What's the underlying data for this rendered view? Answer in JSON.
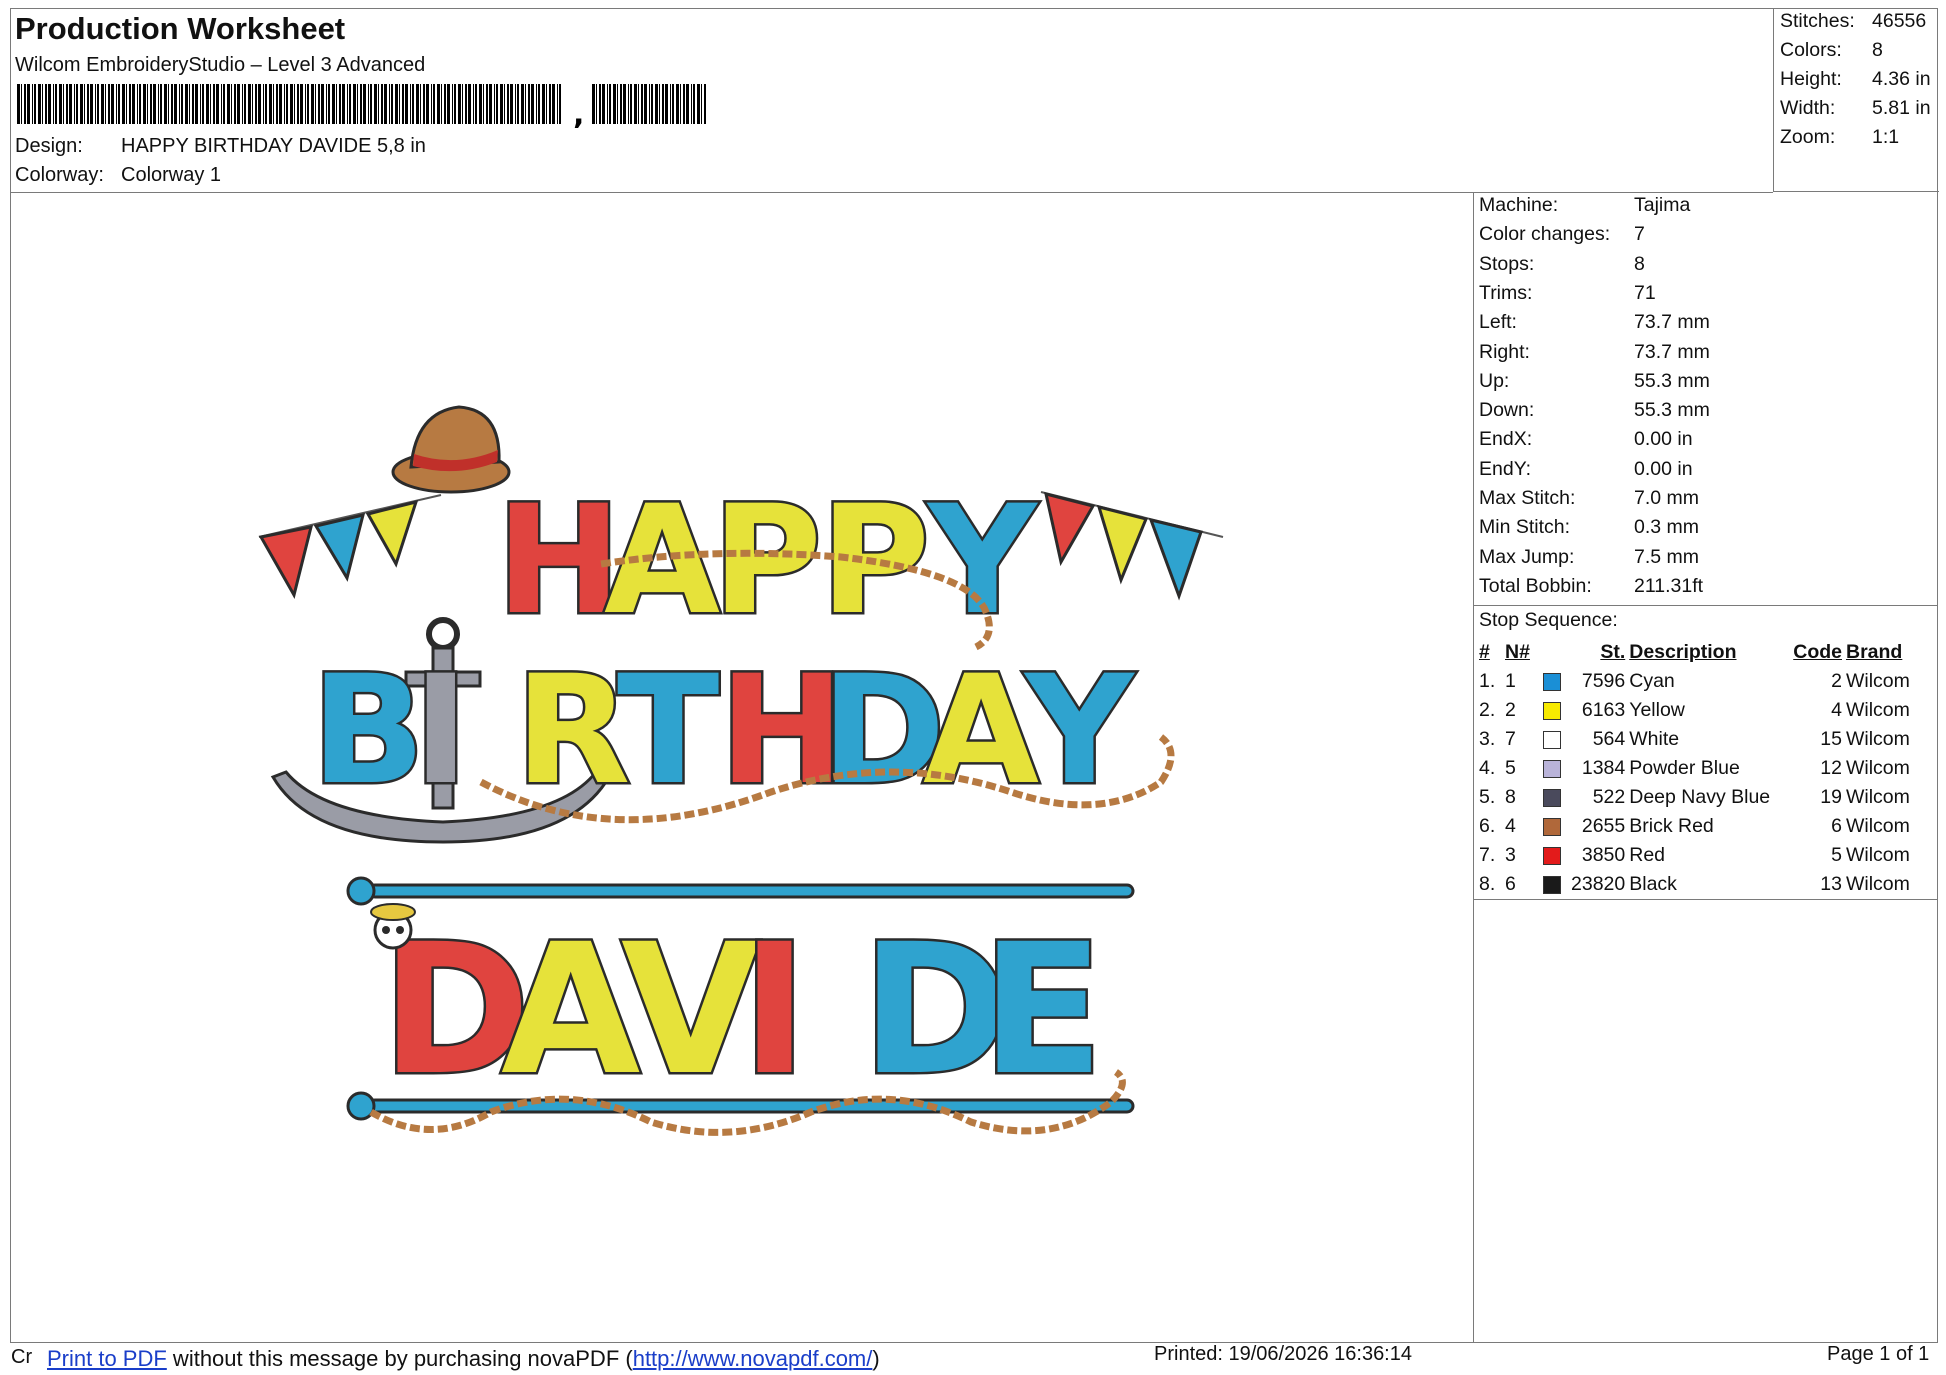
{
  "header": {
    "title": "Production Worksheet",
    "software": "Wilcom EmbroideryStudio – Level 3 Advanced",
    "barcode_suffix": ",",
    "design_label": "Design:",
    "design_value": "HAPPY BIRTHDAY DAVIDE 5,8 in",
    "colorway_label": "Colorway:",
    "colorway_value": "Colorway 1"
  },
  "stats": [
    {
      "label": "Stitches:",
      "value": "46556"
    },
    {
      "label": "Colors:",
      "value": "8"
    },
    {
      "label": "Height:",
      "value": "4.36 in"
    },
    {
      "label": "Width:",
      "value": "5.81 in"
    },
    {
      "label": "Zoom:",
      "value": "1:1"
    }
  ],
  "properties": [
    {
      "label": "Machine:",
      "value": "Tajima"
    },
    {
      "label": "Color changes:",
      "value": "7"
    },
    {
      "label": "Stops:",
      "value": "8"
    },
    {
      "label": "Trims:",
      "value": "71"
    },
    {
      "label": "Left:",
      "value": "73.7 mm"
    },
    {
      "label": "Right:",
      "value": "73.7 mm"
    },
    {
      "label": "Up:",
      "value": "55.3 mm"
    },
    {
      "label": "Down:",
      "value": "55.3 mm"
    },
    {
      "label": "EndX:",
      "value": "0.00 in"
    },
    {
      "label": "EndY:",
      "value": "0.00 in"
    },
    {
      "label": "Max Stitch:",
      "value": "7.0 mm"
    },
    {
      "label": "Min Stitch:",
      "value": "0.3 mm"
    },
    {
      "label": "Max Jump:",
      "value": "7.5 mm"
    },
    {
      "label": "Total Bobbin:",
      "value": "211.31ft"
    }
  ],
  "stop_sequence": {
    "label": "Stop Sequence:",
    "headers": {
      "num": "#",
      "n": "N#",
      "st": "St.",
      "desc": "Description",
      "code": "Code",
      "brand": "Brand"
    },
    "rows": [
      {
        "num": "1.",
        "n": "1",
        "color": "#1a8fd6",
        "st": "7596",
        "desc": "Cyan",
        "code": "2",
        "brand": "Wilcom"
      },
      {
        "num": "2.",
        "n": "2",
        "color": "#f7ea00",
        "st": "6163",
        "desc": "Yellow",
        "code": "4",
        "brand": "Wilcom"
      },
      {
        "num": "3.",
        "n": "7",
        "color": "#ffffff",
        "st": "564",
        "desc": "White",
        "code": "15",
        "brand": "Wilcom"
      },
      {
        "num": "4.",
        "n": "5",
        "color": "#b9b3d9",
        "st": "1384",
        "desc": "Powder Blue",
        "code": "12",
        "brand": "Wilcom"
      },
      {
        "num": "5.",
        "n": "8",
        "color": "#4a4a5c",
        "st": "522",
        "desc": "Deep Navy Blue",
        "code": "19",
        "brand": "Wilcom"
      },
      {
        "num": "6.",
        "n": "4",
        "color": "#b0683a",
        "st": "2655",
        "desc": "Brick Red",
        "code": "6",
        "brand": "Wilcom"
      },
      {
        "num": "7.",
        "n": "3",
        "color": "#e31b1b",
        "st": "3850",
        "desc": "Red",
        "code": "5",
        "brand": "Wilcom"
      },
      {
        "num": "8.",
        "n": "6",
        "color": "#1a1a1a",
        "st": "23820",
        "desc": "Black",
        "code": "13",
        "brand": "Wilcom"
      }
    ]
  },
  "design": {
    "line1": [
      "H",
      "A",
      "P",
      "P",
      "Y"
    ],
    "line2": [
      "B",
      "I",
      "R",
      "T",
      "H",
      "D",
      "A",
      "Y"
    ],
    "line3": [
      "D",
      "A",
      "V",
      "I",
      "D",
      "E"
    ],
    "palette": {
      "red": "#e0443f",
      "yellow": "#e6e23a",
      "cyan": "#2fa3cf",
      "outline": "#2b2b2b",
      "rope": "#b77a42",
      "anchor": "#9a9ca6"
    }
  },
  "footer": {
    "cr": "Cr",
    "link_text": "Print to PDF",
    "msg": " without this message by purchasing novaPDF (",
    "url": "http://www.novapdf.com/",
    "close": ")",
    "printed": "Printed: 19/06/2026 16:36:14",
    "page": "Page 1 of 1"
  }
}
